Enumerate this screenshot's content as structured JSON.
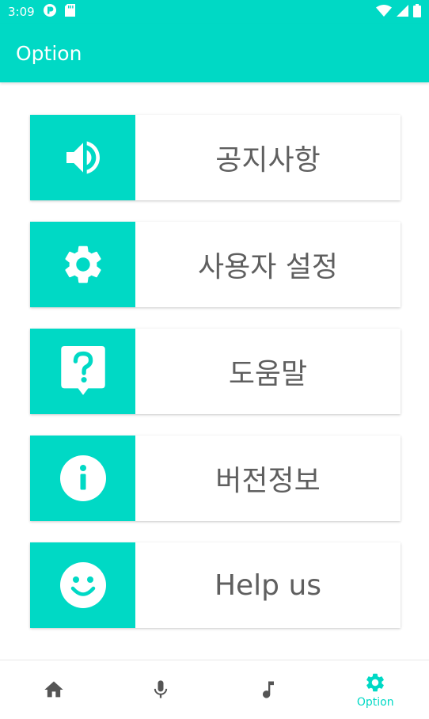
{
  "status_bar": {
    "time": "3:09",
    "icons": [
      "notification-app-icon",
      "sd-card-icon",
      "wifi-icon",
      "signal-icon",
      "battery-icon"
    ]
  },
  "app_bar": {
    "title": "Option"
  },
  "menu": [
    {
      "label": "공지사항",
      "icon": "speaker-icon"
    },
    {
      "label": "사용자 설정",
      "icon": "gear-icon"
    },
    {
      "label": "도움말",
      "icon": "help-icon"
    },
    {
      "label": "버전정보",
      "icon": "info-icon"
    },
    {
      "label": "Help us",
      "icon": "smiley-icon"
    }
  ],
  "bottom_nav": {
    "items": [
      {
        "icon": "home-icon",
        "label": ""
      },
      {
        "icon": "mic-icon",
        "label": ""
      },
      {
        "icon": "music-note-icon",
        "label": ""
      },
      {
        "icon": "gear-icon",
        "label": "Option",
        "active": true
      }
    ]
  },
  "colors": {
    "accent": "#00d9c5",
    "nav_icon_inactive": "#555555",
    "label_text": "#5f5f5f"
  }
}
